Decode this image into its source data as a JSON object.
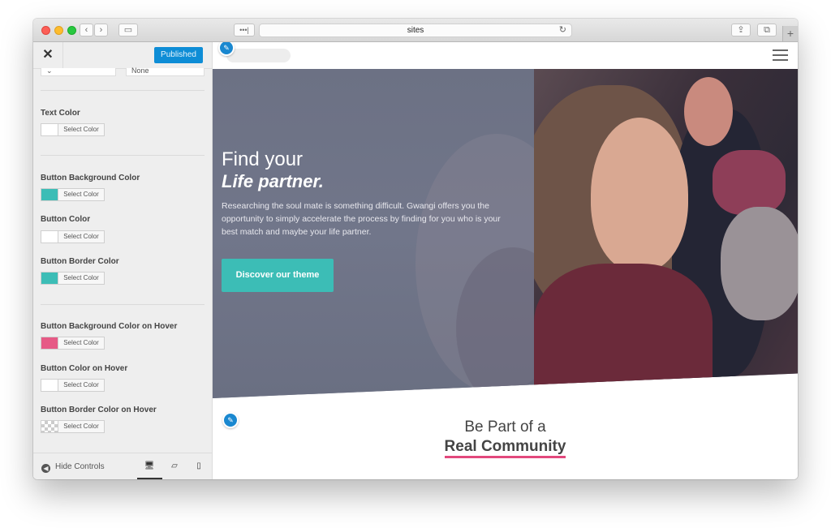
{
  "browser": {
    "address": "sites",
    "reader_icon": "more-icon",
    "reload_icon": "reload-icon"
  },
  "customizer": {
    "close_label": "✕",
    "publish_label": "Published",
    "top_select_right": "None",
    "fields": [
      {
        "label": "Text Color",
        "swatch": "#ffffff",
        "button": "Select Color"
      },
      {
        "label": "Button Background Color",
        "swatch": "#3cbdb6",
        "button": "Select Color"
      },
      {
        "label": "Button Color",
        "swatch": "#ffffff",
        "button": "Select Color"
      },
      {
        "label": "Button Border Color",
        "swatch": "#3cbdb6",
        "button": "Select Color"
      },
      {
        "label": "Button Background Color on Hover",
        "swatch": "#e65a86",
        "button": "Select Color"
      },
      {
        "label": "Button Color on Hover",
        "swatch": "#ffffff",
        "button": "Select Color"
      },
      {
        "label": "Button Border Color on Hover",
        "swatch": "transparent",
        "button": "Select Color"
      }
    ],
    "footer": {
      "hide_controls": "Hide Controls"
    }
  },
  "preview": {
    "hero": {
      "title_line1": "Find your",
      "title_line2": "Life partner.",
      "text": "Researching the soul mate is something difficult. Gwangi offers you the opportunity to simply accelerate the process by finding for you who is your best match and maybe your life partner.",
      "button": "Discover our theme"
    },
    "section": {
      "title_line1": "Be Part of a",
      "title_line2": "Real Community"
    }
  },
  "colors": {
    "accent_teal": "#3cbdb6",
    "accent_pink": "#e2487c",
    "publish_blue": "#0e8dd6"
  }
}
